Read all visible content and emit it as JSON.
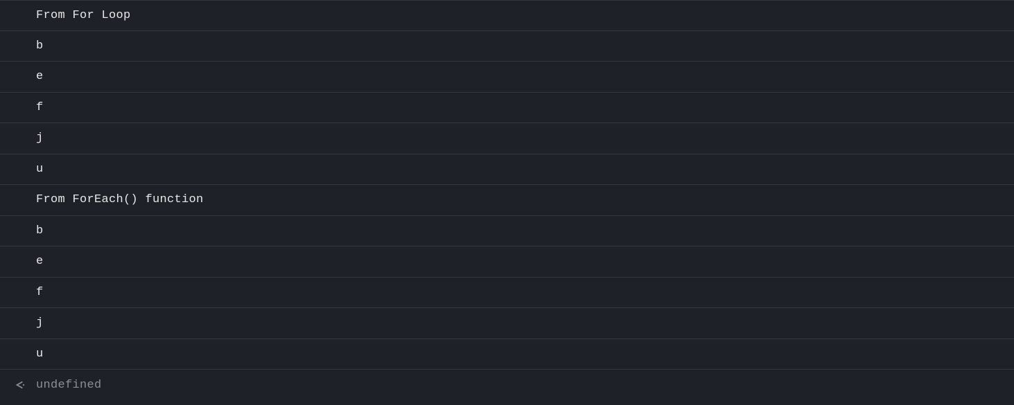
{
  "console": {
    "lines": [
      "From For Loop",
      "b",
      "e",
      "f",
      "j",
      "u",
      "From ForEach() function",
      "b",
      "e",
      "f",
      "j",
      "u"
    ],
    "result": "undefined"
  }
}
